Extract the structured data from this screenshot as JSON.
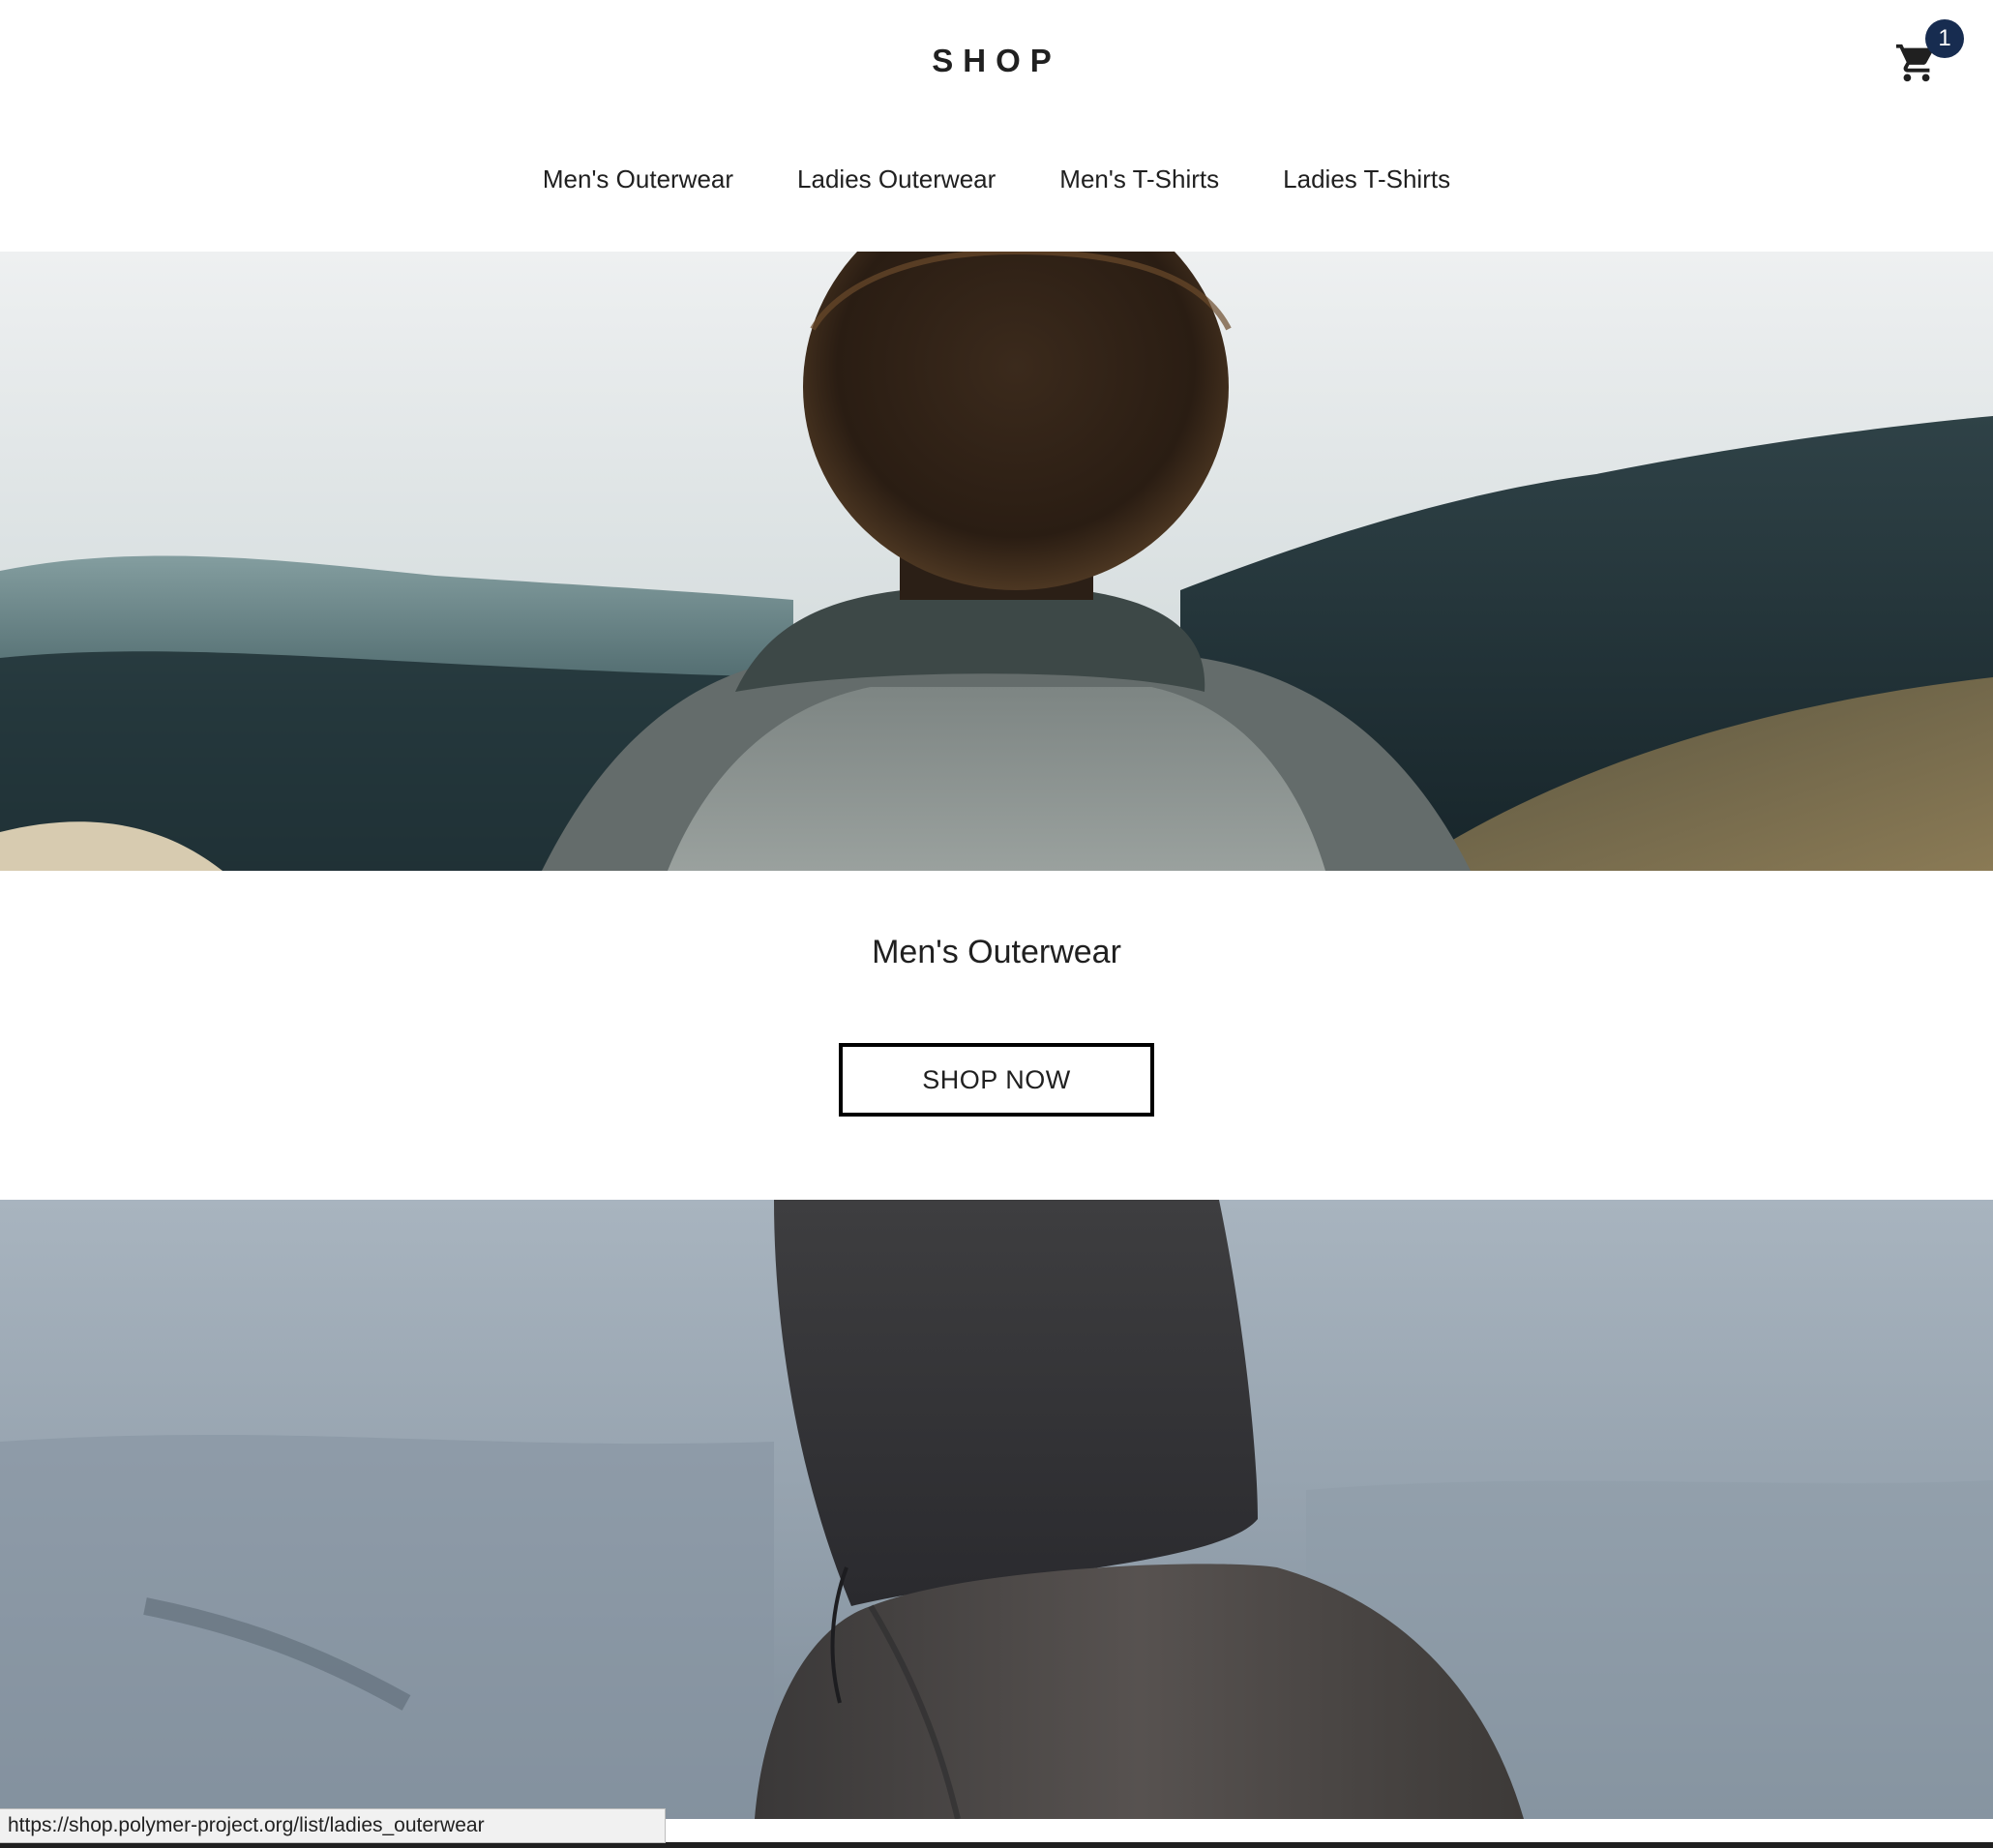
{
  "header": {
    "logo": "SHOP",
    "cart": {
      "icon": "shopping-cart-icon",
      "badge_count": "1",
      "badge_color": "#172c50"
    }
  },
  "nav": {
    "items": [
      {
        "label": "Men's Outerwear"
      },
      {
        "label": "Ladies Outerwear"
      },
      {
        "label": "Men's T-Shirts"
      },
      {
        "label": "Ladies T-Shirts"
      }
    ]
  },
  "sections": [
    {
      "title": "Men's Outerwear",
      "button_label": "SHOP NOW"
    }
  ],
  "status_bar": {
    "url": "https://shop.polymer-project.org/list/ladies_outerwear"
  }
}
